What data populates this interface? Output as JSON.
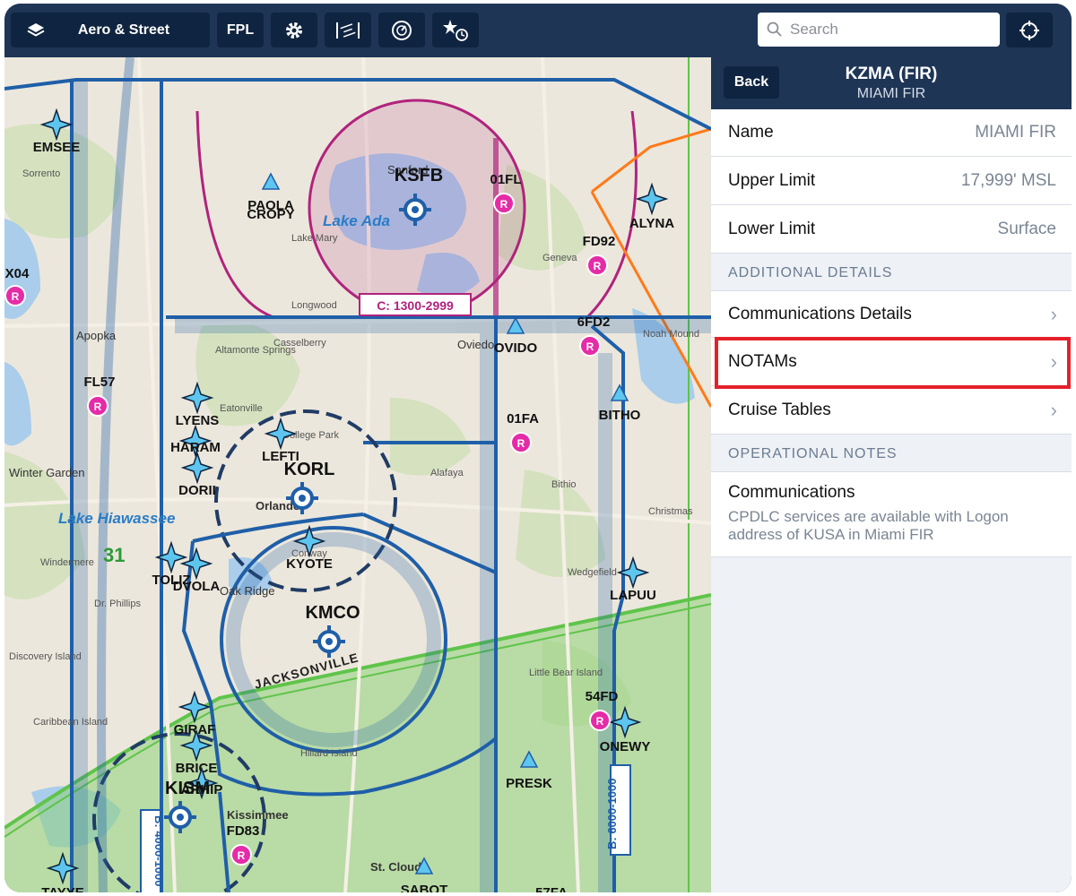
{
  "toolbar": {
    "layers_label": "Aero & Street",
    "fpl_label": "FPL",
    "search_placeholder": "Search"
  },
  "map": {
    "waypoints": [
      "EMSEE",
      "PAOLA",
      "CROPY",
      "ALYNA",
      "LYENS",
      "HARAM",
      "DORII",
      "LEFTI",
      "KYOTE",
      "TOLIZ",
      "DVOLA",
      "GIRAF",
      "BRICE",
      "ARHIP",
      "BITHO",
      "LAPUU",
      "ONEWY",
      "PRESK",
      "OVIDO",
      "SABOT",
      "TAYYE",
      "57FA"
    ],
    "airports": [
      "KSFB",
      "KORL",
      "KMCO",
      "KISM"
    ],
    "private_fields": [
      "01FL",
      "FD92",
      "6FD2",
      "FL57",
      "01FA",
      "54FD",
      "FD83",
      "X04"
    ],
    "towns": [
      "Sanford",
      "Sorrento",
      "Apopka",
      "Altamonte Springs",
      "Casselberry",
      "College Park",
      "Eatonville",
      "Oviedo",
      "Geneva",
      "Longwood",
      "Lake Mary",
      "Winter Garden",
      "Orlando",
      "Oak Ridge",
      "Windermere",
      "Dr. Phillips",
      "Conway",
      "Alafaya",
      "Bithio",
      "Christmas",
      "Wedgefield",
      "Kissimmee",
      "St. Cloud",
      "Discovery Island",
      "Little Bear Island",
      "Hillard Island",
      "Noah Mound",
      "Caribbean Island",
      "Paola"
    ],
    "water": [
      "Lake Ada",
      "Lake Hiawassee"
    ],
    "airspace_labels": [
      "C: 1300-2999",
      "B: 4000-1000",
      "B: 6000-1000",
      "JACKSONVILLE"
    ],
    "chart_number": "31"
  },
  "panel": {
    "back_label": "Back",
    "title": "KZMA (FIR)",
    "subtitle": "MIAMI FIR",
    "details": [
      {
        "label": "Name",
        "value": "MIAMI FIR"
      },
      {
        "label": "Upper Limit",
        "value": "17,999' MSL"
      },
      {
        "label": "Lower Limit",
        "value": "Surface"
      }
    ],
    "additional_header": "ADDITIONAL DETAILS",
    "additional": [
      {
        "label": "Communications Details"
      },
      {
        "label": "NOTAMs"
      },
      {
        "label": "Cruise Tables"
      }
    ],
    "operational_header": "OPERATIONAL NOTES",
    "notes": {
      "title": "Communications",
      "text": "CPDLC services are available with Logon address of KUSA in Miami FIR"
    }
  },
  "colors": {
    "toolbar_bg": "#1e3556",
    "button_bg": "#0f2440",
    "class_b": "#1f5fa8",
    "class_c": "#b0237d",
    "highlight": "#e4212b"
  }
}
